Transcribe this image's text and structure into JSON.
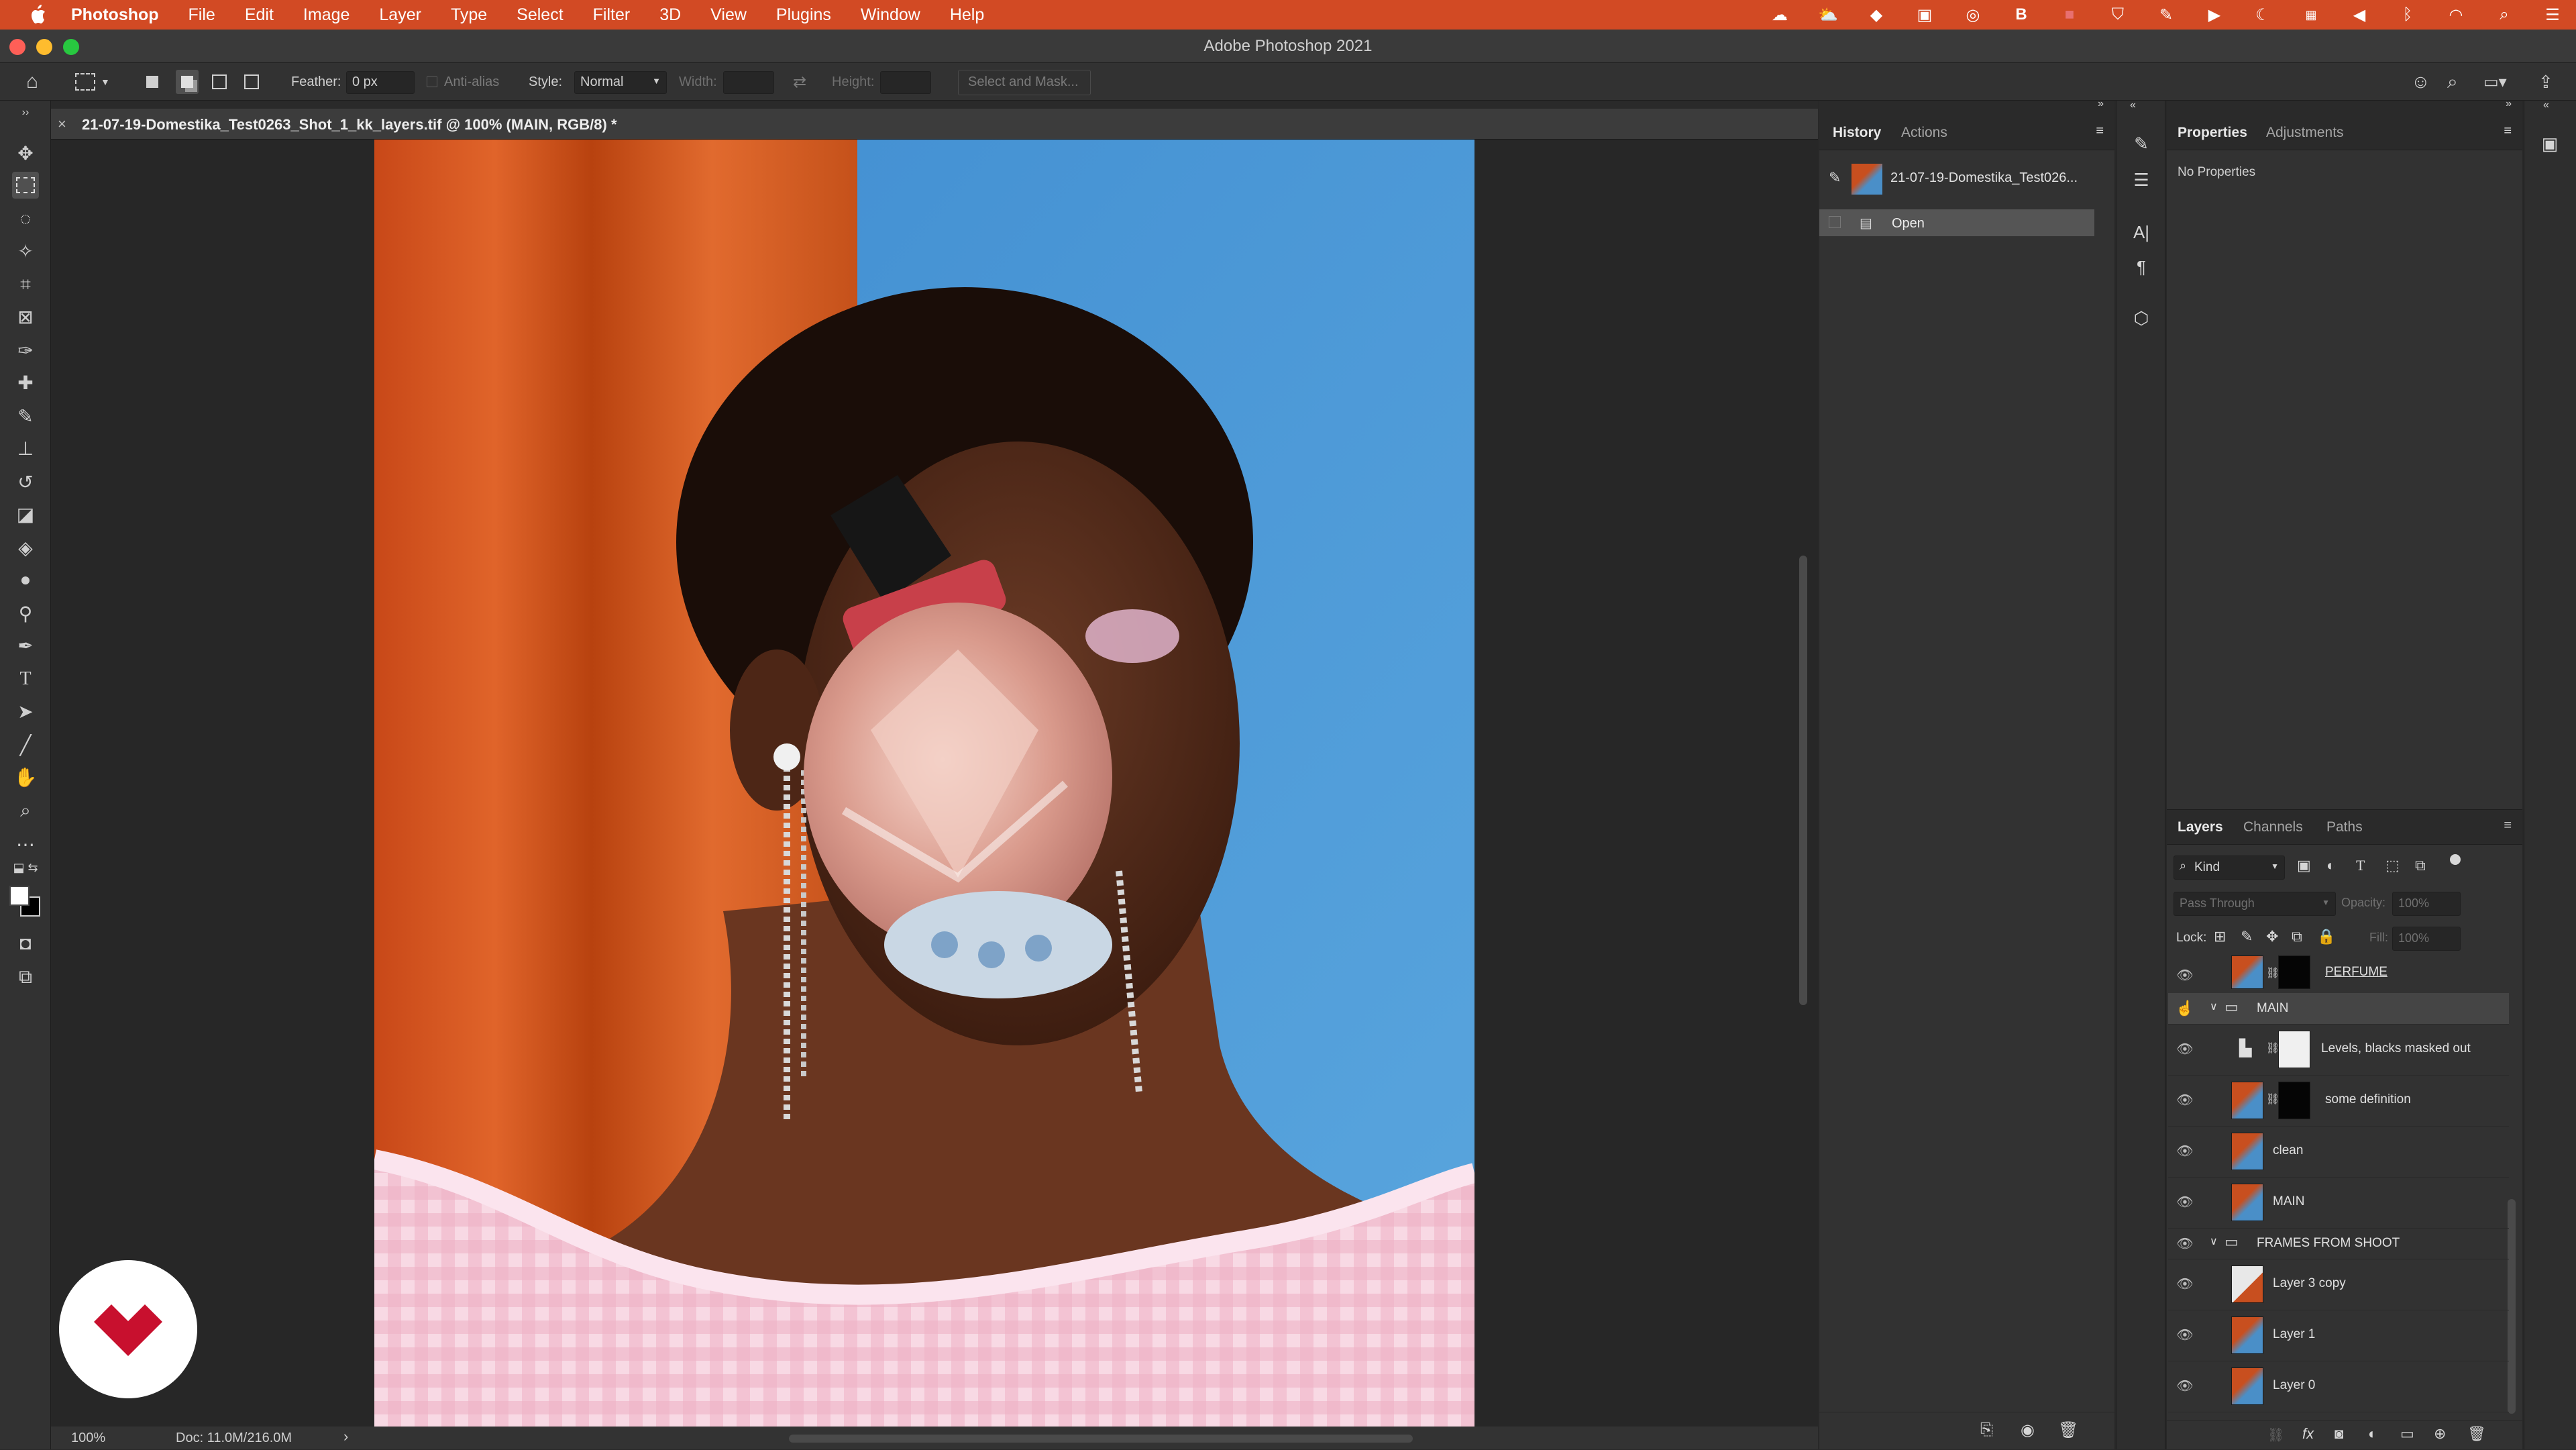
{
  "menubar": {
    "app_name": "Photoshop",
    "items": [
      "File",
      "Edit",
      "Image",
      "Layer",
      "Type",
      "Select",
      "Filter",
      "3D",
      "View",
      "Plugins",
      "Window",
      "Help"
    ],
    "status_icons": [
      "creative-cloud-icon",
      "cloud-sync-icon",
      "dropbox-icon",
      "screen-record-icon",
      "cast-icon",
      "b-app-icon",
      "red-dot-icon",
      "shield-icon",
      "evernote-icon",
      "play-icon",
      "moon-icon",
      "flag-uk-icon",
      "volume-icon",
      "bluetooth-icon",
      "wifi-icon",
      "search-icon",
      "control-center-icon"
    ]
  },
  "window": {
    "title": "Adobe Photoshop 2021"
  },
  "options": {
    "feather_label": "Feather:",
    "feather_value": "0 px",
    "antialias_label": "Anti-alias",
    "style_label": "Style:",
    "style_value": "Normal",
    "width_label": "Width:",
    "height_label": "Height:",
    "select_mask": "Select and Mask..."
  },
  "document": {
    "tab_title": "21-07-19-Domestika_Test0263_Shot_1_kk_layers.tif @ 100% (MAIN, RGB/8) *",
    "zoom": "100%",
    "doc_size": "Doc: 11.0M/216.0M"
  },
  "history": {
    "tabs": [
      "History",
      "Actions"
    ],
    "snapshot_name": "21-07-19-Domestika_Test026...",
    "items": [
      "Open"
    ]
  },
  "properties": {
    "tabs": [
      "Properties",
      "Adjustments"
    ],
    "empty_text": "No Properties"
  },
  "layers": {
    "tabs": [
      "Layers",
      "Channels",
      "Paths"
    ],
    "filter_kind": "Kind",
    "blend_mode": "Pass Through",
    "opacity_label": "Opacity:",
    "opacity_value": "100%",
    "lock_label": "Lock:",
    "fill_label": "Fill:",
    "fill_value": "100%",
    "rows": [
      {
        "name": "PERFUME"
      },
      {
        "name": "MAIN"
      },
      {
        "name": "Levels, blacks masked out"
      },
      {
        "name": "some definition"
      },
      {
        "name": "clean"
      },
      {
        "name": "MAIN"
      },
      {
        "name": "FRAMES FROM SHOOT"
      },
      {
        "name": "Layer 3 copy"
      },
      {
        "name": "Layer 1"
      },
      {
        "name": "Layer 0"
      }
    ]
  },
  "colors": {
    "menubar": "#d24a24",
    "brand_logo": "#c8102e"
  }
}
